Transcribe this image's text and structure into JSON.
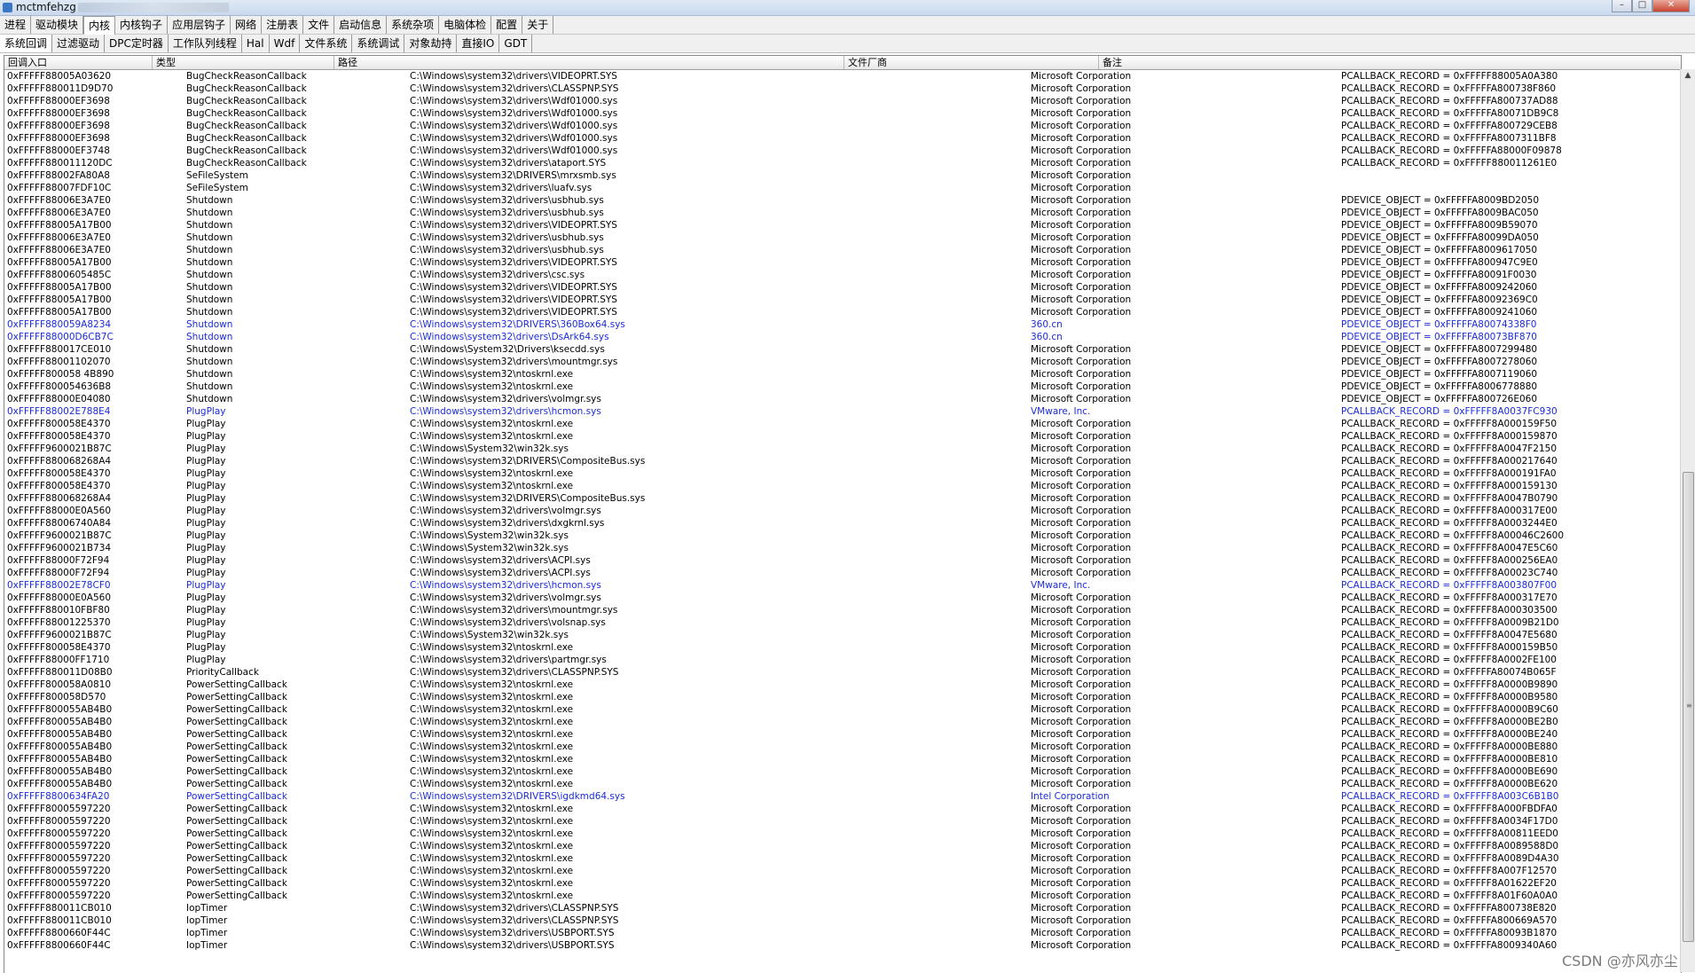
{
  "window": {
    "title": "mctmfehzg",
    "min": "–",
    "max": "□",
    "close": "✕"
  },
  "menu_tabs": [
    "进程",
    "驱动模块",
    "内核",
    "内核钩子",
    "应用层钩子",
    "网络",
    "注册表",
    "文件",
    "启动信息",
    "系统杂项",
    "电脑体检",
    "配置",
    "关于"
  ],
  "sub_tabs": [
    "系统回调",
    "过滤驱动",
    "DPC定时器",
    "工作队列线程",
    "Hal",
    "Wdf",
    "文件系统",
    "系统调试",
    "对象劫持",
    "直接IO",
    "GDT"
  ],
  "columns": [
    "回调入口",
    "类型",
    "路径",
    "文件厂商",
    "备注"
  ],
  "rows": [
    [
      "0xFFFFF88005A03620",
      "BugCheckReasonCallback",
      "C:\\Windows\\system32\\drivers\\VIDEOPRT.SYS",
      "Microsoft Corporation",
      "PCALLBACK_RECORD = 0xFFFFF88005A0A380"
    ],
    [
      "0xFFFFF880011D9D70",
      "BugCheckReasonCallback",
      "C:\\Windows\\system32\\drivers\\CLASSPNP.SYS",
      "Microsoft Corporation",
      "PCALLBACK_RECORD = 0xFFFFFA800738F860"
    ],
    [
      "0xFFFFF88000EF3698",
      "BugCheckReasonCallback",
      "C:\\Windows\\system32\\drivers\\Wdf01000.sys",
      "Microsoft Corporation",
      "PCALLBACK_RECORD = 0xFFFFFA800737AD88"
    ],
    [
      "0xFFFFF88000EF3698",
      "BugCheckReasonCallback",
      "C:\\Windows\\system32\\drivers\\Wdf01000.sys",
      "Microsoft Corporation",
      "PCALLBACK_RECORD = 0xFFFFFA80071DB9C8"
    ],
    [
      "0xFFFFF88000EF3698",
      "BugCheckReasonCallback",
      "C:\\Windows\\system32\\drivers\\Wdf01000.sys",
      "Microsoft Corporation",
      "PCALLBACK_RECORD = 0xFFFFFA800729CEB8"
    ],
    [
      "0xFFFFF88000EF3698",
      "BugCheckReasonCallback",
      "C:\\Windows\\system32\\drivers\\Wdf01000.sys",
      "Microsoft Corporation",
      "PCALLBACK_RECORD = 0xFFFFFA8007311BF8"
    ],
    [
      "0xFFFFF88000EF3748",
      "BugCheckReasonCallback",
      "C:\\Windows\\system32\\drivers\\Wdf01000.sys",
      "Microsoft Corporation",
      "PCALLBACK_RECORD = 0xFFFFFA88000F09878"
    ],
    [
      "0xFFFFF880011120DC",
      "BugCheckReasonCallback",
      "C:\\Windows\\system32\\drivers\\ataport.SYS",
      "Microsoft Corporation",
      "PCALLBACK_RECORD = 0xFFFFF880011261E0"
    ],
    [
      "0xFFFFF88002FA80A8",
      "SeFileSystem",
      "C:\\Windows\\system32\\DRIVERS\\mrxsmb.sys",
      "Microsoft Corporation",
      ""
    ],
    [
      "0xFFFFF88007FDF10C",
      "SeFileSystem",
      "C:\\Windows\\system32\\drivers\\luafv.sys",
      "Microsoft Corporation",
      ""
    ],
    [
      "0xFFFFF88006E3A7E0",
      "Shutdown",
      "C:\\Windows\\system32\\drivers\\usbhub.sys",
      "Microsoft Corporation",
      "PDEVICE_OBJECT = 0xFFFFFA8009BD2050"
    ],
    [
      "0xFFFFF88006E3A7E0",
      "Shutdown",
      "C:\\Windows\\system32\\drivers\\usbhub.sys",
      "Microsoft Corporation",
      "PDEVICE_OBJECT = 0xFFFFFA8009BAC050"
    ],
    [
      "0xFFFFF88005A17B00",
      "Shutdown",
      "C:\\Windows\\system32\\drivers\\VIDEOPRT.SYS",
      "Microsoft Corporation",
      "PDEVICE_OBJECT = 0xFFFFFA8009B59070"
    ],
    [
      "0xFFFFF88006E3A7E0",
      "Shutdown",
      "C:\\Windows\\system32\\drivers\\usbhub.sys",
      "Microsoft Corporation",
      "PDEVICE_OBJECT = 0xFFFFFA80099DA050"
    ],
    [
      "0xFFFFF88006E3A7E0",
      "Shutdown",
      "C:\\Windows\\system32\\drivers\\usbhub.sys",
      "Microsoft Corporation",
      "PDEVICE_OBJECT = 0xFFFFFA8009617050"
    ],
    [
      "0xFFFFF88005A17B00",
      "Shutdown",
      "C:\\Windows\\system32\\drivers\\VIDEOPRT.SYS",
      "Microsoft Corporation",
      "PDEVICE_OBJECT = 0xFFFFFA800947C9E0"
    ],
    [
      "0xFFFFF8800605485C",
      "Shutdown",
      "C:\\Windows\\system32\\drivers\\csc.sys",
      "Microsoft Corporation",
      "PDEVICE_OBJECT = 0xFFFFFA80091F0030"
    ],
    [
      "0xFFFFF88005A17B00",
      "Shutdown",
      "C:\\Windows\\system32\\drivers\\VIDEOPRT.SYS",
      "Microsoft Corporation",
      "PDEVICE_OBJECT = 0xFFFFFA8009242060"
    ],
    [
      "0xFFFFF88005A17B00",
      "Shutdown",
      "C:\\Windows\\system32\\drivers\\VIDEOPRT.SYS",
      "Microsoft Corporation",
      "PDEVICE_OBJECT = 0xFFFFFA80092369C0"
    ],
    [
      "0xFFFFF88005A17B00",
      "Shutdown",
      "C:\\Windows\\system32\\drivers\\VIDEOPRT.SYS",
      "Microsoft Corporation",
      "PDEVICE_OBJECT = 0xFFFFFA8009241060"
    ],
    [
      "0xFFFFF880059A8234",
      "Shutdown",
      "C:\\Windows\\system32\\DRIVERS\\360Box64.sys",
      "360.cn",
      "PDEVICE_OBJECT = 0xFFFFFA80074338F0"
    ],
    [
      "0xFFFFF88000D6CB7C",
      "Shutdown",
      "C:\\Windows\\system32\\drivers\\DsArk64.sys",
      "360.cn",
      "PDEVICE_OBJECT = 0xFFFFFA80073BF870"
    ],
    [
      "0xFFFFF880017CE010",
      "Shutdown",
      "C:\\Windows\\System32\\Drivers\\ksecdd.sys",
      "Microsoft Corporation",
      "PDEVICE_OBJECT = 0xFFFFFA8007299480"
    ],
    [
      "0xFFFFF88001102070",
      "Shutdown",
      "C:\\Windows\\system32\\drivers\\mountmgr.sys",
      "Microsoft Corporation",
      "PDEVICE_OBJECT = 0xFFFFFA8007278060"
    ],
    [
      "0xFFFFF800058 4B890",
      "Shutdown",
      "C:\\Windows\\system32\\ntoskrnl.exe",
      "Microsoft Corporation",
      "PDEVICE_OBJECT = 0xFFFFFA8007119060"
    ],
    [
      "0xFFFFF800054636B8",
      "Shutdown",
      "C:\\Windows\\system32\\ntoskrnl.exe",
      "Microsoft Corporation",
      "PDEVICE_OBJECT = 0xFFFFFA8006778880"
    ],
    [
      "0xFFFFF88000E04080",
      "Shutdown",
      "C:\\Windows\\system32\\drivers\\volmgr.sys",
      "Microsoft Corporation",
      "PDEVICE_OBJECT = 0xFFFFFA800726E060"
    ],
    [
      "0xFFFFF88002E788E4",
      "PlugPlay",
      "C:\\Windows\\system32\\drivers\\hcmon.sys",
      "VMware, Inc.",
      "PCALLBACK_RECORD = 0xFFFFF8A0037FC930"
    ],
    [
      "0xFFFFF800058E4370",
      "PlugPlay",
      "C:\\Windows\\system32\\ntoskrnl.exe",
      "Microsoft Corporation",
      "PCALLBACK_RECORD = 0xFFFFF8A000159F50"
    ],
    [
      "0xFFFFF800058E4370",
      "PlugPlay",
      "C:\\Windows\\system32\\ntoskrnl.exe",
      "Microsoft Corporation",
      "PCALLBACK_RECORD = 0xFFFFF8A000159870"
    ],
    [
      "0xFFFFF9600021B87C",
      "PlugPlay",
      "C:\\Windows\\System32\\win32k.sys",
      "Microsoft Corporation",
      "PCALLBACK_RECORD = 0xFFFFF8A0047F2150"
    ],
    [
      "0xFFFFF880068268A4",
      "PlugPlay",
      "C:\\Windows\\system32\\DRIVERS\\CompositeBus.sys",
      "Microsoft Corporation",
      "PCALLBACK_RECORD = 0xFFFFF8A000217640"
    ],
    [
      "0xFFFFF800058E4370",
      "PlugPlay",
      "C:\\Windows\\system32\\ntoskrnl.exe",
      "Microsoft Corporation",
      "PCALLBACK_RECORD = 0xFFFFF8A000191FA0"
    ],
    [
      "0xFFFFF800058E4370",
      "PlugPlay",
      "C:\\Windows\\system32\\ntoskrnl.exe",
      "Microsoft Corporation",
      "PCALLBACK_RECORD = 0xFFFFF8A000159130"
    ],
    [
      "0xFFFFF880068268A4",
      "PlugPlay",
      "C:\\Windows\\system32\\DRIVERS\\CompositeBus.sys",
      "Microsoft Corporation",
      "PCALLBACK_RECORD = 0xFFFFF8A0047B0790"
    ],
    [
      "0xFFFFF88000E0A560",
      "PlugPlay",
      "C:\\Windows\\system32\\drivers\\volmgr.sys",
      "Microsoft Corporation",
      "PCALLBACK_RECORD = 0xFFFFF8A000317E00"
    ],
    [
      "0xFFFFF88006740A84",
      "PlugPlay",
      "C:\\Windows\\system32\\drivers\\dxgkrnl.sys",
      "Microsoft Corporation",
      "PCALLBACK_RECORD = 0xFFFFF8A0003244E0"
    ],
    [
      "0xFFFFF9600021B87C",
      "PlugPlay",
      "C:\\Windows\\System32\\win32k.sys",
      "Microsoft Corporation",
      "PCALLBACK_RECORD = 0xFFFFF8A00046C2600"
    ],
    [
      "0xFFFFF9600021B734",
      "PlugPlay",
      "C:\\Windows\\System32\\win32k.sys",
      "Microsoft Corporation",
      "PCALLBACK_RECORD = 0xFFFFF8A0047E5C60"
    ],
    [
      "0xFFFFF88000F72F94",
      "PlugPlay",
      "C:\\Windows\\system32\\drivers\\ACPI.sys",
      "Microsoft Corporation",
      "PCALLBACK_RECORD = 0xFFFFF8A000256EA0"
    ],
    [
      "0xFFFFF88000F72F94",
      "PlugPlay",
      "C:\\Windows\\system32\\drivers\\ACPI.sys",
      "Microsoft Corporation",
      "PCALLBACK_RECORD = 0xFFFFF8A00023C740"
    ],
    [
      "0xFFFFF88002E78CF0",
      "PlugPlay",
      "C:\\Windows\\system32\\drivers\\hcmon.sys",
      "VMware, Inc.",
      "PCALLBACK_RECORD = 0xFFFFF8A003807F00"
    ],
    [
      "0xFFFFF88000E0A560",
      "PlugPlay",
      "C:\\Windows\\system32\\drivers\\volmgr.sys",
      "Microsoft Corporation",
      "PCALLBACK_RECORD = 0xFFFFF8A000317E70"
    ],
    [
      "0xFFFFF880010FBF80",
      "PlugPlay",
      "C:\\Windows\\system32\\drivers\\mountmgr.sys",
      "Microsoft Corporation",
      "PCALLBACK_RECORD = 0xFFFFF8A000303500"
    ],
    [
      "0xFFFFF88001225370",
      "PlugPlay",
      "C:\\Windows\\system32\\drivers\\volsnap.sys",
      "Microsoft Corporation",
      "PCALLBACK_RECORD = 0xFFFFF8A0009B21D0"
    ],
    [
      "0xFFFFF9600021B87C",
      "PlugPlay",
      "C:\\Windows\\System32\\win32k.sys",
      "Microsoft Corporation",
      "PCALLBACK_RECORD = 0xFFFFF8A0047E5680"
    ],
    [
      "0xFFFFF800058E4370",
      "PlugPlay",
      "C:\\Windows\\system32\\ntoskrnl.exe",
      "Microsoft Corporation",
      "PCALLBACK_RECORD = 0xFFFFF8A000159B50"
    ],
    [
      "0xFFFFF88000FF1710",
      "PlugPlay",
      "C:\\Windows\\system32\\drivers\\partmgr.sys",
      "Microsoft Corporation",
      "PCALLBACK_RECORD = 0xFFFFF8A0002FE100"
    ],
    [
      "0xFFFFF880011D08B0",
      "PriorityCallback",
      "C:\\Windows\\system32\\drivers\\CLASSPNP.SYS",
      "Microsoft Corporation",
      "PCALLBACK_RECORD = 0xFFFFFA80074B065F"
    ],
    [
      "0xFFFFF800058A0810",
      "PowerSettingCallback",
      "C:\\Windows\\system32\\ntoskrnl.exe",
      "Microsoft Corporation",
      "PCALLBACK_RECORD = 0xFFFFF8A0000B9890"
    ],
    [
      "0xFFFFF800058D570",
      "PowerSettingCallback",
      "C:\\Windows\\system32\\ntoskrnl.exe",
      "Microsoft Corporation",
      "PCALLBACK_RECORD = 0xFFFFF8A0000B9580"
    ],
    [
      "0xFFFFF800055AB4B0",
      "PowerSettingCallback",
      "C:\\Windows\\system32\\ntoskrnl.exe",
      "Microsoft Corporation",
      "PCALLBACK_RECORD = 0xFFFFF8A0000B9C60"
    ],
    [
      "0xFFFFF800055AB4B0",
      "PowerSettingCallback",
      "C:\\Windows\\system32\\ntoskrnl.exe",
      "Microsoft Corporation",
      "PCALLBACK_RECORD = 0xFFFFF8A0000BE2B0"
    ],
    [
      "0xFFFFF800055AB4B0",
      "PowerSettingCallback",
      "C:\\Windows\\system32\\ntoskrnl.exe",
      "Microsoft Corporation",
      "PCALLBACK_RECORD = 0xFFFFF8A0000BE240"
    ],
    [
      "0xFFFFF800055AB4B0",
      "PowerSettingCallback",
      "C:\\Windows\\system32\\ntoskrnl.exe",
      "Microsoft Corporation",
      "PCALLBACK_RECORD = 0xFFFFF8A0000BE880"
    ],
    [
      "0xFFFFF800055AB4B0",
      "PowerSettingCallback",
      "C:\\Windows\\system32\\ntoskrnl.exe",
      "Microsoft Corporation",
      "PCALLBACK_RECORD = 0xFFFFF8A0000BE810"
    ],
    [
      "0xFFFFF800055AB4B0",
      "PowerSettingCallback",
      "C:\\Windows\\system32\\ntoskrnl.exe",
      "Microsoft Corporation",
      "PCALLBACK_RECORD = 0xFFFFF8A0000BE690"
    ],
    [
      "0xFFFFF800055AB4B0",
      "PowerSettingCallback",
      "C:\\Windows\\system32\\ntoskrnl.exe",
      "Microsoft Corporation",
      "PCALLBACK_RECORD = 0xFFFFF8A0000BE620"
    ],
    [
      "0xFFFFF8800634FA20",
      "PowerSettingCallback",
      "C:\\Windows\\system32\\DRIVERS\\igdkmd64.sys",
      "Intel Corporation",
      "PCALLBACK_RECORD = 0xFFFFF8A003C6B1B0"
    ],
    [
      "0xFFFFF80005597220",
      "PowerSettingCallback",
      "C:\\Windows\\system32\\ntoskrnl.exe",
      "Microsoft Corporation",
      "PCALLBACK_RECORD = 0xFFFFF8A000FBDFA0"
    ],
    [
      "0xFFFFF80005597220",
      "PowerSettingCallback",
      "C:\\Windows\\system32\\ntoskrnl.exe",
      "Microsoft Corporation",
      "PCALLBACK_RECORD = 0xFFFFF8A0034F17D0"
    ],
    [
      "0xFFFFF80005597220",
      "PowerSettingCallback",
      "C:\\Windows\\system32\\ntoskrnl.exe",
      "Microsoft Corporation",
      "PCALLBACK_RECORD = 0xFFFFF8A00811EED0"
    ],
    [
      "0xFFFFF80005597220",
      "PowerSettingCallback",
      "C:\\Windows\\system32\\ntoskrnl.exe",
      "Microsoft Corporation",
      "PCALLBACK_RECORD = 0xFFFFF8A0089588D0"
    ],
    [
      "0xFFFFF80005597220",
      "PowerSettingCallback",
      "C:\\Windows\\system32\\ntoskrnl.exe",
      "Microsoft Corporation",
      "PCALLBACK_RECORD = 0xFFFFF8A0089D4A30"
    ],
    [
      "0xFFFFF80005597220",
      "PowerSettingCallback",
      "C:\\Windows\\system32\\ntoskrnl.exe",
      "Microsoft Corporation",
      "PCALLBACK_RECORD = 0xFFFFF8A007F12570"
    ],
    [
      "0xFFFFF80005597220",
      "PowerSettingCallback",
      "C:\\Windows\\system32\\ntoskrnl.exe",
      "Microsoft Corporation",
      "PCALLBACK_RECORD = 0xFFFFF8A01622EF20"
    ],
    [
      "0xFFFFF80005597220",
      "PowerSettingCallback",
      "C:\\Windows\\system32\\ntoskrnl.exe",
      "Microsoft Corporation",
      "PCALLBACK_RECORD = 0xFFFFF8A01F60A0A0"
    ],
    [
      "0xFFFFF880011CB010",
      "IopTimer",
      "C:\\Windows\\system32\\drivers\\CLASSPNP.SYS",
      "Microsoft Corporation",
      "PCALLBACK_RECORD = 0xFFFFFA800738E820"
    ],
    [
      "0xFFFFF880011CB010",
      "IopTimer",
      "C:\\Windows\\system32\\drivers\\CLASSPNP.SYS",
      "Microsoft Corporation",
      "PCALLBACK_RECORD = 0xFFFFFA800669A570"
    ],
    [
      "0xFFFFF8800660F44C",
      "IopTimer",
      "C:\\Windows\\system32\\drivers\\USBPORT.SYS",
      "Microsoft Corporation",
      "PCALLBACK_RECORD = 0xFFFFFA80093B1870"
    ],
    [
      "0xFFFFF8800660F44C",
      "IopTimer",
      "C:\\Windows\\system32\\drivers\\USBPORT.SYS",
      "Microsoft Corporation",
      "PCALLBACK_RECORD = 0xFFFFFA8009340A60"
    ]
  ],
  "highlight_rows": [
    20,
    21,
    27,
    41,
    58
  ],
  "highlight_color": "#1a2bd8",
  "watermark": "CSDN @亦风亦尘"
}
